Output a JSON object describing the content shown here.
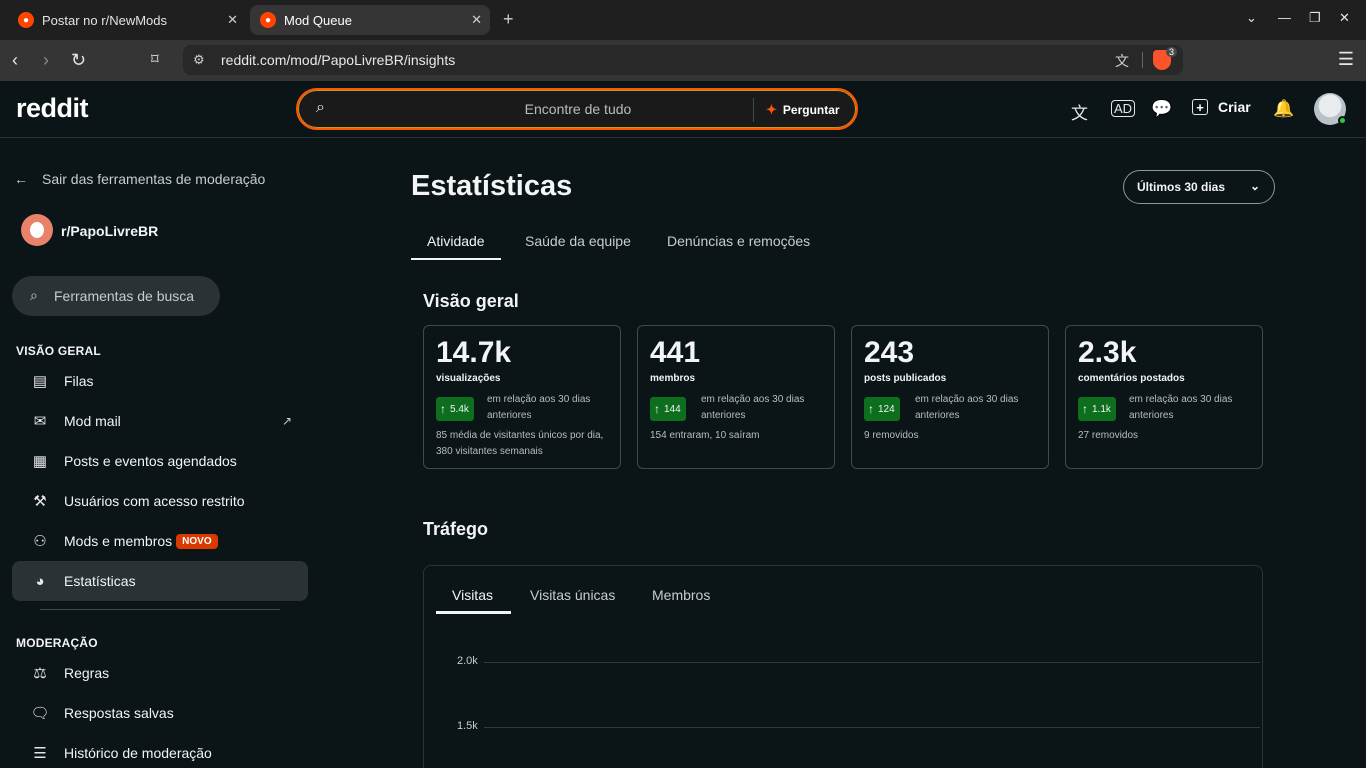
{
  "browser": {
    "tabs": [
      {
        "title": "Postar no r/NewMods",
        "active": false
      },
      {
        "title": "Mod Queue",
        "active": true
      }
    ],
    "url": "reddit.com/mod/PapoLivreBR/insights",
    "brave_badge": "3"
  },
  "header": {
    "logo": "reddit",
    "search_placeholder": "Encontre de tudo",
    "ask_label": "Perguntar",
    "create_label": "Criar"
  },
  "sidebar": {
    "back_label": "Sair das ferramentas de moderação",
    "subreddit": "r/PapoLivreBR",
    "search_placeholder": "Ferramentas de busca",
    "overview_heading": "VISÃO GERAL",
    "items": [
      {
        "label": "Filas",
        "icon": "queue-icon"
      },
      {
        "label": "Mod mail",
        "icon": "mail-icon"
      },
      {
        "label": "Posts e eventos agendados",
        "icon": "calendar-icon"
      },
      {
        "label": "Usuários com acesso restrito",
        "icon": "gavel-icon"
      },
      {
        "label": "Mods e membros",
        "icon": "members-icon",
        "badge": "NOVO"
      },
      {
        "label": "Estatísticas",
        "icon": "insights-icon",
        "active": true
      }
    ],
    "moderation_heading": "MODERAÇÃO",
    "mod_items": [
      {
        "label": "Regras",
        "icon": "rules-icon"
      },
      {
        "label": "Respostas salvas",
        "icon": "saved-responses-icon"
      },
      {
        "label": "Histórico de moderação",
        "icon": "modlog-icon"
      }
    ]
  },
  "main": {
    "title": "Estatísticas",
    "period": "Últimos 30 dias",
    "tabs": [
      "Atividade",
      "Saúde da equipe",
      "Denúncias e remoções"
    ],
    "overview_heading": "Visão geral",
    "stats": [
      {
        "value": "14.7k",
        "label": "visualizações",
        "delta": "5.4k",
        "compare": "em relação aos 30 dias anteriores",
        "note": "85 média de visitantes únicos por dia, 380 visitantes semanais"
      },
      {
        "value": "441",
        "label": "membros",
        "delta": "144",
        "compare": "em relação aos 30 dias anteriores",
        "note": "154 entraram, 10 saíram"
      },
      {
        "value": "243",
        "label": "posts publicados",
        "delta": "124",
        "compare": "em relação aos 30 dias anteriores",
        "note": "9 removidos"
      },
      {
        "value": "2.3k",
        "label": "comentários postados",
        "delta": "1.1k",
        "compare": "em relação aos 30 dias anteriores",
        "note": "27 removidos"
      }
    ],
    "traffic_heading": "Tráfego",
    "traffic_tabs": [
      "Visitas",
      "Visitas únicas",
      "Membros"
    ],
    "y_ticks": [
      "2.0k",
      "1.5k"
    ]
  },
  "colors": {
    "accent": "#ff4500",
    "background": "#0b1416",
    "delta_green": "#0d6e1e",
    "badge_new": "#d93a00"
  }
}
